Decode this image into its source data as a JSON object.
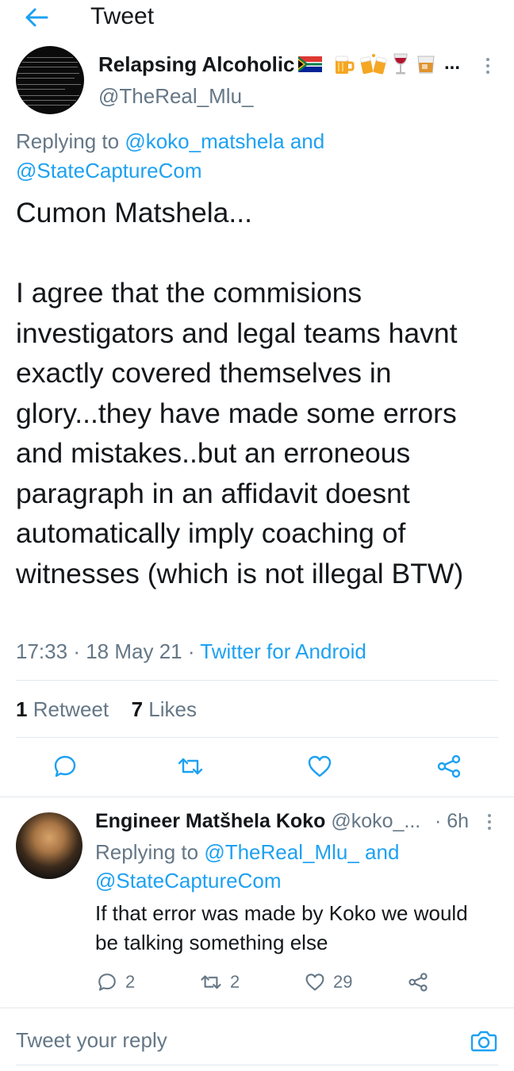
{
  "header": {
    "title": "Tweet",
    "back_icon": "arrow-left-icon"
  },
  "colors": {
    "accent": "#1da1f2",
    "text_primary": "#14171a",
    "text_secondary": "#657786",
    "divider": "#e1e8ed"
  },
  "main_tweet": {
    "display_name": "Relapsing Alcoholic",
    "name_emojis": [
      "south-africa-flag-icon",
      "beer-mug-icon",
      "clinking-beer-mugs-icon",
      "wine-glass-icon",
      "tumbler-glass-icon"
    ],
    "name_ellipsis": "...",
    "handle": "@TheReal_Mlu_",
    "replying_prefix": "Replying to",
    "replying_user_1": "@koko_matshela",
    "replying_and": "and",
    "replying_user_2": "@StateCaptureCom",
    "body": "Cumon Matshela...\n\nI agree that the commisions investigators and legal teams havnt exactly covered themselves in glory...they have made some errors and mistakes..but an erroneous paragraph in an affidavit doesnt automatically imply coaching of witnesses (which is not illegal BTW)",
    "time": "17:33",
    "date": "18 May 21",
    "source": "Twitter for Android",
    "retweet_count": "1",
    "retweet_label": "Retweet",
    "like_count": "7",
    "like_label": "Likes"
  },
  "reply_tweet": {
    "display_name": "Engineer Matšhela Koko",
    "handle": "@koko_...",
    "time": "· 6h",
    "replying_prefix": "Replying to",
    "replying_user_1": "@TheReal_Mlu_",
    "replying_and": "and",
    "replying_user_2": "@StateCaptureCom",
    "text": "If that error was made by Koko we would be talking something else",
    "reply_count": "2",
    "retweet_count": "2",
    "like_count": "29"
  },
  "compose": {
    "placeholder": "Tweet your reply",
    "camera_icon": "camera-icon"
  }
}
